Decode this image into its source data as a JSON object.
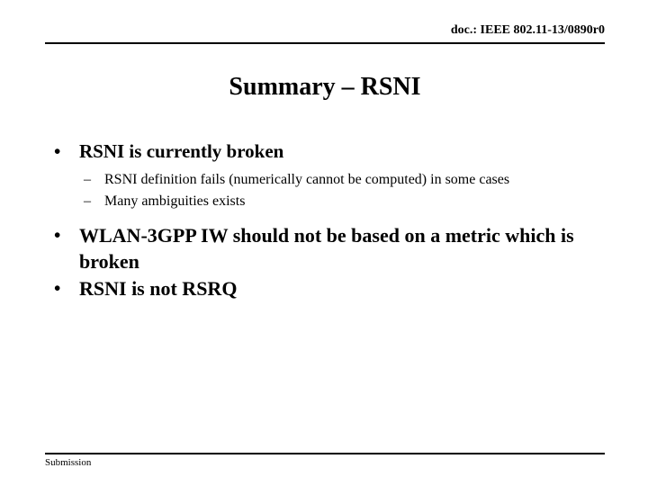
{
  "header": {
    "doc_label": "doc.: IEEE 802.11-13/0890r0"
  },
  "title": "Summary – RSNI",
  "bullets": [
    {
      "marker": "•",
      "text": "RSNI is currently broken",
      "level": 1,
      "size": "normal"
    },
    {
      "marker": "–",
      "text": "RSNI definition fails (numerically cannot be computed) in some cases",
      "level": 2,
      "size": "normal"
    },
    {
      "marker": "–",
      "text": "Many ambiguities exists",
      "level": 2,
      "size": "normal"
    },
    {
      "marker": "•",
      "text": "WLAN-3GPP IW should not be based on a metric which is broken",
      "level": 1,
      "size": "big"
    },
    {
      "marker": "•",
      "text": "RSNI is not RSRQ",
      "level": 1,
      "size": "big"
    }
  ],
  "footer": {
    "left_label": "Submission",
    "right_label": ""
  },
  "colors": {
    "text": "#000000",
    "background": "#ffffff",
    "rule": "#000000"
  }
}
